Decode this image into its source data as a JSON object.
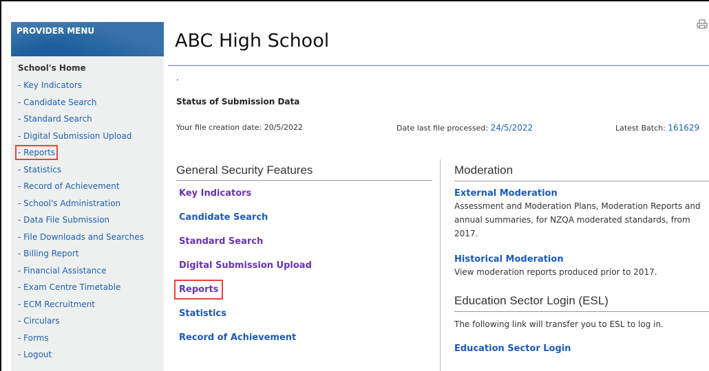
{
  "sidebar": {
    "header": "PROVIDER MENU",
    "home": "School's Home",
    "items": [
      {
        "label": "- Key Indicators"
      },
      {
        "label": "- Candidate Search"
      },
      {
        "label": "- Standard Search"
      },
      {
        "label": "- Digital Submission Upload"
      },
      {
        "label": "- Reports"
      },
      {
        "label": "- Statistics"
      },
      {
        "label": "- Record of Achievement"
      },
      {
        "label": "- School's Administration"
      },
      {
        "label": "- Data File Submission"
      },
      {
        "label": "- File Downloads and Searches"
      },
      {
        "label": "- Billing Report"
      },
      {
        "label": "- Financial Assistance"
      },
      {
        "label": "- Exam Centre Timetable"
      },
      {
        "label": "- ECM Recruitment"
      },
      {
        "label": "- Circulars"
      },
      {
        "label": "- Forms"
      },
      {
        "label": "- Logout"
      }
    ]
  },
  "page": {
    "title": "ABC High School",
    "dot": ".",
    "status_heading": "Status of Submission Data",
    "file_creation_label": "Your file creation date: 20/5/2022",
    "last_processed_label": "Date last file processed:",
    "last_processed_value": "24/5/2022",
    "latest_batch_label": "Latest Batch:",
    "latest_batch_value": "161629"
  },
  "security": {
    "heading": "General Security Features",
    "links": [
      {
        "label": "Key Indicators"
      },
      {
        "label": "Candidate Search"
      },
      {
        "label": "Standard Search"
      },
      {
        "label": "Digital Submission Upload"
      },
      {
        "label": "Reports"
      },
      {
        "label": "Statistics"
      },
      {
        "label": "Record of Achievement"
      }
    ]
  },
  "moderation": {
    "heading": "Moderation",
    "external_title": "External Moderation",
    "external_desc": "Assessment and Moderation Plans, Moderation Reports and annual summaries, for NZQA moderated standards, from 2017.",
    "historical_title": "Historical Moderation",
    "historical_desc": "View moderation reports produced prior to 2017."
  },
  "esl": {
    "heading": "Education Sector Login (ESL)",
    "desc": "The following link will transfer you to ESL to log in.",
    "link": "Education Sector Login"
  },
  "colors": {
    "link_blue": "#1a5bb5",
    "link_purple": "#6a32b0",
    "highlight_red": "#e8433c",
    "menu_header_blue": "#1d5f9e"
  }
}
